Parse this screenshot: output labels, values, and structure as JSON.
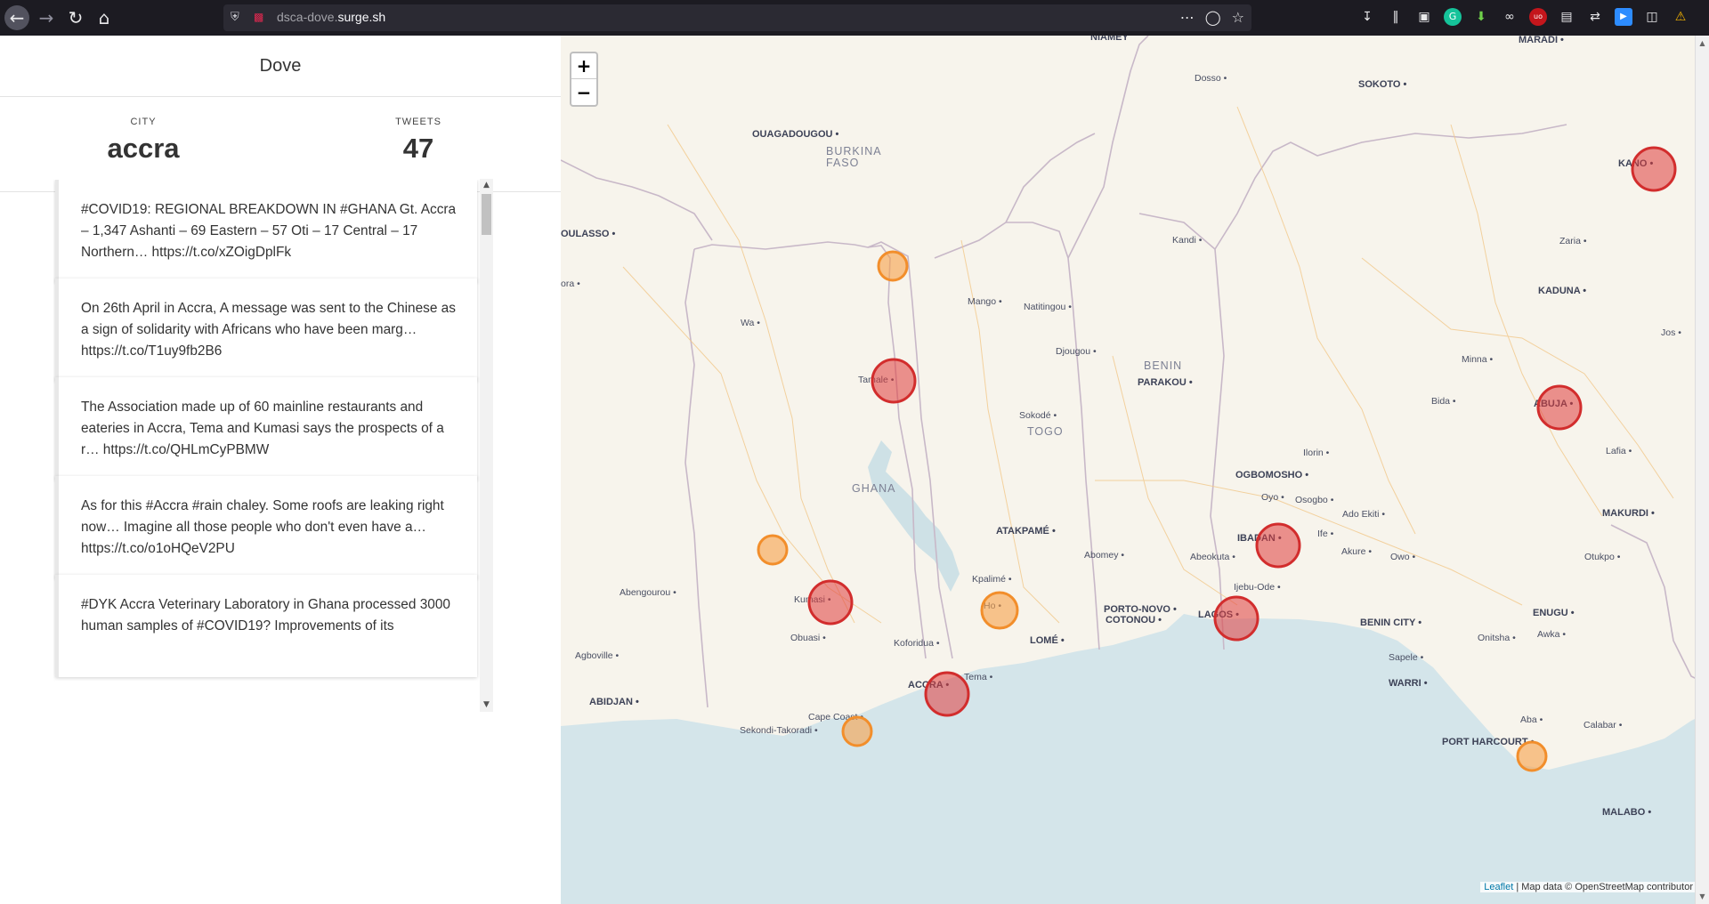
{
  "browser": {
    "url_dim": "dsca-dove.",
    "url_host": "surge.sh",
    "icons": [
      "back-arrow-icon",
      "forward-arrow-icon",
      "reload-icon",
      "home-icon",
      "shield-icon",
      "insecure-lock-icon",
      "more-dots-icon",
      "pocket-icon",
      "star-icon"
    ]
  },
  "app": {
    "title": "Dove",
    "city_label": "CITY",
    "city_value": "accra",
    "tweets_label": "TWEETS",
    "tweets_value": "47"
  },
  "tweets": [
    "#COVID19: REGIONAL BREAKDOWN IN #GHANA Gt. Accra – 1,347 Ashanti – 69 Eastern – 57 Oti – 17 Central – 17 Northern… https://t.co/xZOigDplFk",
    "On 26th April in Accra, A message was sent to the Chinese as a sign of solidarity with Africans who have been marg… https://t.co/T1uy9fb2B6",
    "The Association made up of 60 mainline restaurants and eateries in Accra, Tema and Kumasi says the prospects of a r… https://t.co/QHLmCyPBMW",
    "As for this #Accra #rain chaley. Some roofs are leaking right now… Imagine all those people who don't even have a… https://t.co/o1oHQeV2PU",
    "#DYK Accra Veterinary Laboratory in Ghana processed 3000 human samples of #COVID19? Improvements of its"
  ],
  "map": {
    "zoom_in": "+",
    "zoom_out": "−",
    "attribution_link": "Leaflet",
    "attribution_text": " | Map data © OpenStreetMap contributor",
    "colors": {
      "land": "#f7f4ec",
      "sea": "#d4e5ea",
      "high": "#e03c3c",
      "low": "#f7a04a"
    },
    "labels": [
      {
        "text": "OUAGADOUGOU",
        "kind": "cap"
      },
      {
        "text": "BURKINA",
        "kind": "country"
      },
      {
        "text": "FASO",
        "kind": "country"
      },
      {
        "text": "Dosso",
        "kind": "town"
      },
      {
        "text": "SOKOTO",
        "kind": "cap"
      },
      {
        "text": "MARADI",
        "kind": "cap"
      },
      {
        "text": "OULASSO",
        "kind": "cap"
      },
      {
        "text": "ora",
        "kind": "town"
      },
      {
        "text": "Kandi",
        "kind": "town"
      },
      {
        "text": "Zaria",
        "kind": "town"
      },
      {
        "text": "KANO",
        "kind": "cap"
      },
      {
        "text": "KADUNA",
        "kind": "cap"
      },
      {
        "text": "Wa",
        "kind": "town"
      },
      {
        "text": "Mango",
        "kind": "town"
      },
      {
        "text": "Natitingou",
        "kind": "town"
      },
      {
        "text": "Jos",
        "kind": "town"
      },
      {
        "text": "Djougou",
        "kind": "town"
      },
      {
        "text": "Minna",
        "kind": "town"
      },
      {
        "text": "BENIN",
        "kind": "country"
      },
      {
        "text": "PARAKOU",
        "kind": "cap"
      },
      {
        "text": "Tamale",
        "kind": "town"
      },
      {
        "text": "Bida",
        "kind": "town"
      },
      {
        "text": "ABUJA",
        "kind": "cap"
      },
      {
        "text": "Sokodé",
        "kind": "town"
      },
      {
        "text": "TOGO",
        "kind": "country"
      },
      {
        "text": "Lafia",
        "kind": "town"
      },
      {
        "text": "Ilorin",
        "kind": "town"
      },
      {
        "text": "OGBOMOSHO",
        "kind": "cap"
      },
      {
        "text": "GHANA",
        "kind": "country"
      },
      {
        "text": "Oyo",
        "kind": "town"
      },
      {
        "text": "Osogbo",
        "kind": "town"
      },
      {
        "text": "Ado Ekiti",
        "kind": "town"
      },
      {
        "text": "MAKURDI",
        "kind": "cap"
      },
      {
        "text": "ATAKPAMÉ",
        "kind": "cap"
      },
      {
        "text": "IBADAN",
        "kind": "cap"
      },
      {
        "text": "Ife",
        "kind": "town"
      },
      {
        "text": "Abomey",
        "kind": "town"
      },
      {
        "text": "Abeokuta",
        "kind": "town"
      },
      {
        "text": "Akure",
        "kind": "town"
      },
      {
        "text": "Owo",
        "kind": "town"
      },
      {
        "text": "Otukpo",
        "kind": "town"
      },
      {
        "text": "Kpalimé",
        "kind": "town"
      },
      {
        "text": "Abengourou",
        "kind": "town"
      },
      {
        "text": "Kumasi",
        "kind": "town"
      },
      {
        "text": "Ho",
        "kind": "town"
      },
      {
        "text": "Ijebu-Ode",
        "kind": "town"
      },
      {
        "text": "PORTO-NOVO",
        "kind": "cap"
      },
      {
        "text": "COTONOU",
        "kind": "cap"
      },
      {
        "text": "LAGOS",
        "kind": "cap"
      },
      {
        "text": "ENUGU",
        "kind": "cap"
      },
      {
        "text": "BENIN CITY",
        "kind": "cap"
      },
      {
        "text": "Obuasi",
        "kind": "town"
      },
      {
        "text": "Awka",
        "kind": "town"
      },
      {
        "text": "Onitsha",
        "kind": "town"
      },
      {
        "text": "Koforidua",
        "kind": "town"
      },
      {
        "text": "LOMÉ",
        "kind": "cap"
      },
      {
        "text": "Agboville",
        "kind": "town"
      },
      {
        "text": "Sapele",
        "kind": "town"
      },
      {
        "text": "Tema",
        "kind": "town"
      },
      {
        "text": "ACCRA",
        "kind": "cap"
      },
      {
        "text": "WARRI",
        "kind": "cap"
      },
      {
        "text": "ABIDJAN",
        "kind": "cap"
      },
      {
        "text": "Cape Coast",
        "kind": "town"
      },
      {
        "text": "Aba",
        "kind": "town"
      },
      {
        "text": "Calabar",
        "kind": "town"
      },
      {
        "text": "Sekondi-Takoradi",
        "kind": "town"
      },
      {
        "text": "PORT HARCOURT",
        "kind": "cap"
      },
      {
        "text": "MALABO",
        "kind": "cap"
      },
      {
        "text": "NIAMEY",
        "kind": "cap"
      }
    ],
    "markers": [
      {
        "city": "Kano",
        "level": "high"
      },
      {
        "city": "Abuja",
        "level": "high"
      },
      {
        "city": "Tamale",
        "level": "high"
      },
      {
        "city": "Bolgatanga",
        "level": "low"
      },
      {
        "city": "Sunyani",
        "level": "low"
      },
      {
        "city": "Kumasi",
        "level": "high"
      },
      {
        "city": "Ho",
        "level": "low"
      },
      {
        "city": "Ibadan",
        "level": "high"
      },
      {
        "city": "Lagos",
        "level": "high"
      },
      {
        "city": "Accra",
        "level": "high"
      },
      {
        "city": "Cape Coast",
        "level": "low"
      },
      {
        "city": "Port Harcourt",
        "level": "low"
      }
    ]
  }
}
